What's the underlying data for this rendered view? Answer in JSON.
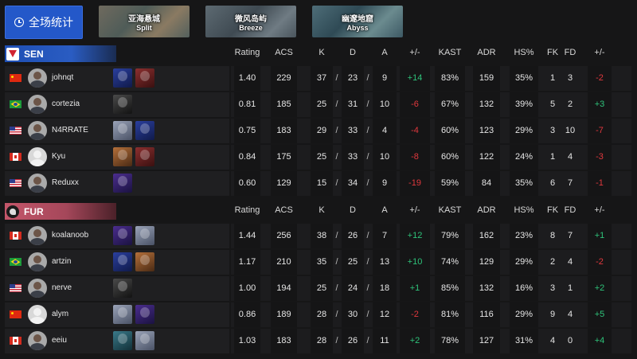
{
  "overall_button": {
    "label": "全场统计",
    "icon": "clock-icon"
  },
  "maps": [
    {
      "cn": "亚海悬城",
      "en": "Split"
    },
    {
      "cn": "微风岛屿",
      "en": "Breeze"
    },
    {
      "cn": "幽邃地窟",
      "en": "Abyss"
    }
  ],
  "columns": [
    "Rating",
    "ACS",
    "K",
    "D",
    "A",
    "+/-",
    "KAST",
    "ADR",
    "HS%",
    "FK",
    "FD",
    "+/-"
  ],
  "teams": [
    {
      "name": "SEN",
      "color": "#2a5cc2",
      "players": [
        {
          "flag": "cn",
          "name": "johnqt",
          "agents": [
            "c-blue",
            "c-red"
          ],
          "rating": "1.40",
          "acs": "229",
          "k": "37",
          "d": "23",
          "a": "9",
          "kd_diff": "+14",
          "kast": "83%",
          "adr": "159",
          "hs": "35%",
          "fk": "1",
          "fd": "3",
          "fk_diff": "-2"
        },
        {
          "flag": "br",
          "name": "cortezia",
          "agents": [
            "c-dark"
          ],
          "rating": "0.81",
          "acs": "185",
          "k": "25",
          "d": "31",
          "a": "10",
          "kd_diff": "-6",
          "kast": "67%",
          "adr": "132",
          "hs": "39%",
          "fk": "5",
          "fd": "2",
          "fk_diff": "+3"
        },
        {
          "flag": "us",
          "name": "N4RRATE",
          "agents": [
            "c-light",
            "c-blue"
          ],
          "rating": "0.75",
          "acs": "183",
          "k": "29",
          "d": "33",
          "a": "4",
          "kd_diff": "-4",
          "kast": "60%",
          "adr": "123",
          "hs": "29%",
          "fk": "3",
          "fd": "10",
          "fk_diff": "-7"
        },
        {
          "flag": "ca",
          "name": "Kyu",
          "agents": [
            "c-orange",
            "c-red"
          ],
          "rating": "0.84",
          "acs": "175",
          "k": "25",
          "d": "33",
          "a": "10",
          "kd_diff": "-8",
          "kast": "60%",
          "adr": "122",
          "hs": "24%",
          "fk": "1",
          "fd": "4",
          "fk_diff": "-3"
        },
        {
          "flag": "us",
          "name": "Reduxx",
          "agents": [
            "c-purple"
          ],
          "rating": "0.60",
          "acs": "129",
          "k": "15",
          "d": "34",
          "a": "9",
          "kd_diff": "-19",
          "kast": "59%",
          "adr": "84",
          "hs": "35%",
          "fk": "6",
          "fd": "7",
          "fk_diff": "-1"
        }
      ]
    },
    {
      "name": "FUR",
      "color": "#c4566a",
      "players": [
        {
          "flag": "ca",
          "name": "koalanoob",
          "agents": [
            "c-purple",
            "c-light"
          ],
          "rating": "1.44",
          "acs": "256",
          "k": "38",
          "d": "26",
          "a": "7",
          "kd_diff": "+12",
          "kast": "79%",
          "adr": "162",
          "hs": "23%",
          "fk": "8",
          "fd": "7",
          "fk_diff": "+1"
        },
        {
          "flag": "br",
          "name": "artzin",
          "agents": [
            "c-blue",
            "c-orange"
          ],
          "rating": "1.17",
          "acs": "210",
          "k": "35",
          "d": "25",
          "a": "13",
          "kd_diff": "+10",
          "kast": "74%",
          "adr": "129",
          "hs": "29%",
          "fk": "2",
          "fd": "4",
          "fk_diff": "-2"
        },
        {
          "flag": "us",
          "name": "nerve",
          "agents": [
            "c-dark"
          ],
          "rating": "1.00",
          "acs": "194",
          "k": "25",
          "d": "24",
          "a": "18",
          "kd_diff": "+1",
          "kast": "85%",
          "adr": "132",
          "hs": "16%",
          "fk": "3",
          "fd": "1",
          "fk_diff": "+2"
        },
        {
          "flag": "cn",
          "name": "alym",
          "agents": [
            "c-light",
            "c-purple"
          ],
          "rating": "0.86",
          "acs": "189",
          "k": "28",
          "d": "30",
          "a": "12",
          "kd_diff": "-2",
          "kast": "81%",
          "adr": "116",
          "hs": "29%",
          "fk": "9",
          "fd": "4",
          "fk_diff": "+5"
        },
        {
          "flag": "ca",
          "name": "eeiu",
          "agents": [
            "c-teal",
            "c-light"
          ],
          "rating": "1.03",
          "acs": "183",
          "k": "28",
          "d": "26",
          "a": "11",
          "kd_diff": "+2",
          "kast": "78%",
          "adr": "127",
          "hs": "31%",
          "fk": "4",
          "fd": "0",
          "fk_diff": "+4"
        }
      ]
    }
  ]
}
